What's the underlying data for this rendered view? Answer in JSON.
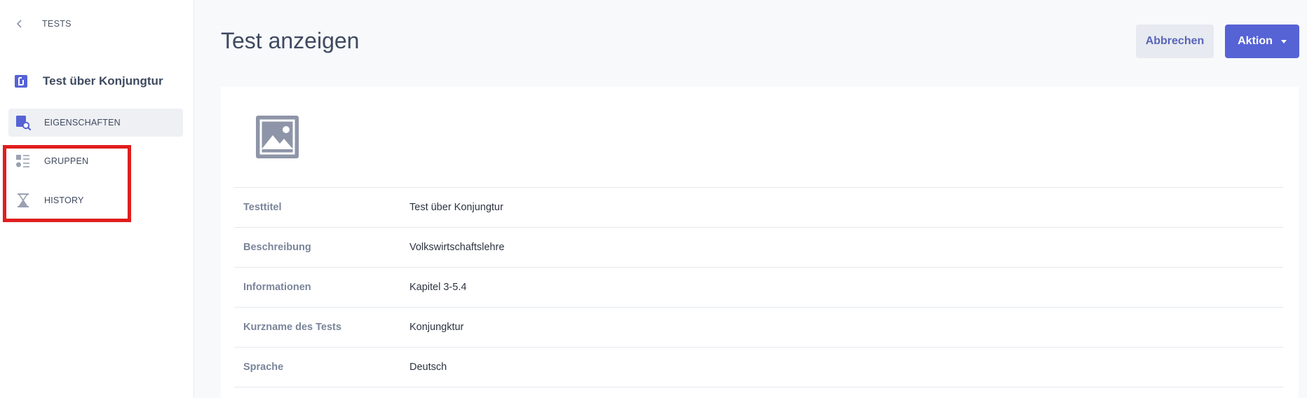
{
  "sidebar": {
    "back_label": "TESTS",
    "test_name": "Test über Konjungtur",
    "items": [
      {
        "label": "EIGENSCHAFTEN",
        "active": true
      },
      {
        "label": "GRUPPEN",
        "active": false
      },
      {
        "label": "HISTORY",
        "active": false
      }
    ]
  },
  "header": {
    "title": "Test anzeigen",
    "cancel_label": "Abbrechen",
    "action_label": "Aktion"
  },
  "properties": [
    {
      "key": "Testtitel",
      "value": "Test über Konjungtur"
    },
    {
      "key": "Beschreibung",
      "value": "Volkswirtschaftslehre"
    },
    {
      "key": "Informationen",
      "value": "Kapitel 3-5.4"
    },
    {
      "key": "Kurzname des Tests",
      "value": "Konjungktur"
    },
    {
      "key": "Sprache",
      "value": "Deutsch"
    }
  ],
  "colors": {
    "accent": "#5663d5",
    "icon": "#5663d5",
    "highlight": "#e11d1d",
    "muted_icon": "#9aa1b1"
  },
  "icons": {
    "back": "chevron-left-icon",
    "test": "test-document-icon",
    "eigenschaften": "properties-search-icon",
    "gruppen": "list-groups-icon",
    "history": "hourglass-icon",
    "image": "image-placeholder-icon"
  }
}
